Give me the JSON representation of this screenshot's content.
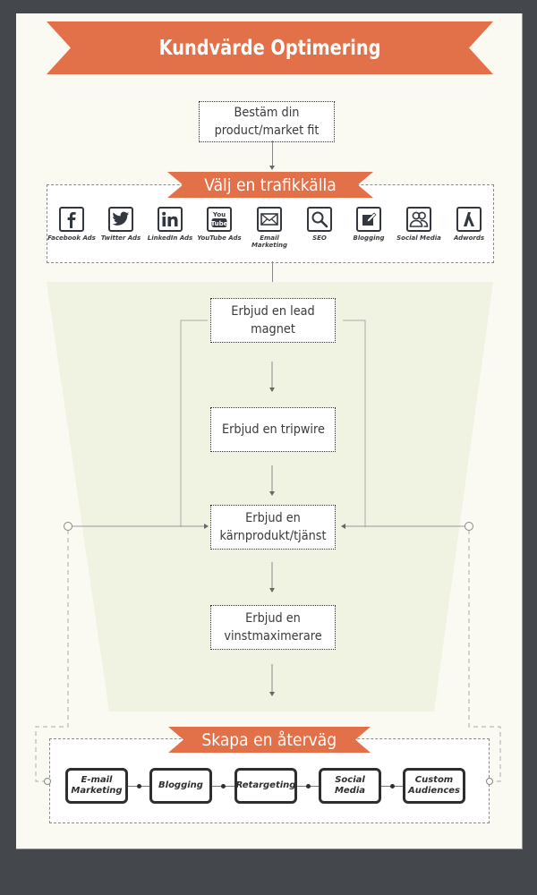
{
  "title": "Kundvärde Optimering",
  "step_fit": "Bestäm din product/market fit",
  "traffic": {
    "heading": "Välj en trafikkälla",
    "sources": [
      {
        "label": "Facebook Ads",
        "icon": "facebook-icon"
      },
      {
        "label": "Twitter Ads",
        "icon": "twitter-icon"
      },
      {
        "label": "LinkedIn Ads",
        "icon": "linkedin-icon"
      },
      {
        "label": "YouTube Ads",
        "icon": "youtube-icon"
      },
      {
        "label": "Email Marketing",
        "icon": "email-icon"
      },
      {
        "label": "SEO",
        "icon": "seo-magnifier-icon"
      },
      {
        "label": "Blogging",
        "icon": "blogging-pen-icon"
      },
      {
        "label": "Social Media",
        "icon": "social-media-people-icon"
      },
      {
        "label": "Adwords",
        "icon": "adwords-icon"
      }
    ]
  },
  "funnel": {
    "steps": [
      "Erbjud en lead magnet",
      "Erbjud en tripwire",
      "Erbjud en kärnprodukt/tjänst",
      "Erbjud en vinstmaximerare"
    ]
  },
  "return_path": {
    "heading": "Skapa en återväg",
    "channels": [
      "E-mail Marketing",
      "Blogging",
      "Retargeting",
      "Social Media",
      "Custom Audiences"
    ]
  },
  "colors": {
    "ribbon": "#e27048",
    "background": "#44474c",
    "panel": "#fafaf3",
    "funnel": "#f0f3e2"
  }
}
